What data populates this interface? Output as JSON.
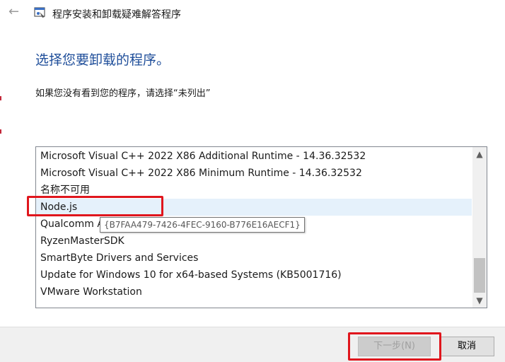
{
  "window": {
    "title": "程序安装和卸载疑难解答程序",
    "back_icon": "arrow-left-icon",
    "app_icon": "troubleshooter-icon"
  },
  "page": {
    "heading": "选择您要卸载的程序。",
    "description": "如果您没有看到您的程序，请选择“未列出”"
  },
  "programs": [
    "Microsoft Visual C++ 2022 X86 Additional Runtime - 14.36.32532",
    "Microsoft Visual C++ 2022 X86 Minimum Runtime - 14.36.32532",
    "名称不可用",
    "Node.js",
    "Qualcomm Atheros",
    "RyzenMasterSDK",
    "SmartByte Drivers and Services",
    "Update for Windows 10 for x64-based Systems (KB5001716)",
    "VMware Workstation"
  ],
  "selected_program": "Node.js",
  "tooltip": "{B7FAA479-7426-4FEC-9160-B776E16AECF1}",
  "buttons": {
    "next": "下一步(N)",
    "cancel": "取消"
  },
  "colors": {
    "heading": "#1f4e9a",
    "annotation_box": "#e0161d",
    "selection": "#e5f1fb"
  }
}
